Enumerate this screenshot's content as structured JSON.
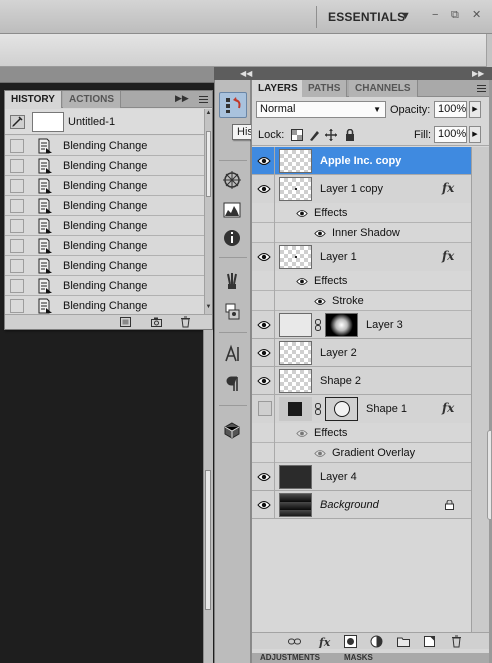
{
  "topbar": {
    "workspace": "ESSENTIALS",
    "workspace_arrow": "▼",
    "minimize": "−",
    "restore": "⧉",
    "close": "✕"
  },
  "history_panel": {
    "tabs": [
      {
        "label": "HISTORY",
        "active": true
      },
      {
        "label": "ACTIONS",
        "active": false
      }
    ],
    "snapshot_label": "Untitled-1",
    "states": [
      "Blending Change",
      "Blending Change",
      "Blending Change",
      "Blending Change",
      "Blending Change",
      "Blending Change",
      "Blending Change",
      "Blending Change",
      "Blending Change"
    ]
  },
  "dock": {
    "tooltip": "History",
    "tools": [
      "history-icon",
      "navigator-icon",
      "histogram-icon",
      "info-icon",
      "brushes-icon",
      "clone-source-icon",
      "character-icon",
      "paragraph-icon",
      "3d-icon"
    ]
  },
  "layers_panel": {
    "tabs": [
      {
        "label": "LAYERS",
        "active": true
      },
      {
        "label": "PATHS",
        "active": false
      },
      {
        "label": "CHANNELS",
        "active": false
      }
    ],
    "blend_mode": "Normal",
    "opacity_label": "Opacity:",
    "opacity_value": "100%",
    "lock_label": "Lock:",
    "fill_label": "Fill:",
    "fill_value": "100%",
    "layers": [
      {
        "name": "Apple Inc. copy",
        "selected": true,
        "visible": true
      },
      {
        "name": "Layer 1 copy",
        "visible": true,
        "fx": "fx",
        "effects_label": "Effects",
        "effects": [
          "Inner Shadow"
        ]
      },
      {
        "name": "Layer 1",
        "visible": true,
        "fx": "fx",
        "effects_label": "Effects",
        "effects": [
          "Stroke"
        ]
      },
      {
        "name": "Layer 3",
        "visible": true
      },
      {
        "name": "Layer 2",
        "visible": true
      },
      {
        "name": "Shape 2",
        "visible": true
      },
      {
        "name": "Shape 1",
        "visible": false,
        "fx": "fx",
        "effects_label": "Effects",
        "effects": [
          "Gradient Overlay"
        ]
      },
      {
        "name": "Layer 4",
        "visible": true
      },
      {
        "name": "Background",
        "visible": true,
        "locked": true
      }
    ],
    "bottom_tabs": [
      "ADJUSTMENTS",
      "MASKS"
    ]
  },
  "colors": {
    "selection": "#3f8ae0",
    "panel_bg": "#d7d7d7",
    "canvas_bg": "#1e1e1e"
  }
}
